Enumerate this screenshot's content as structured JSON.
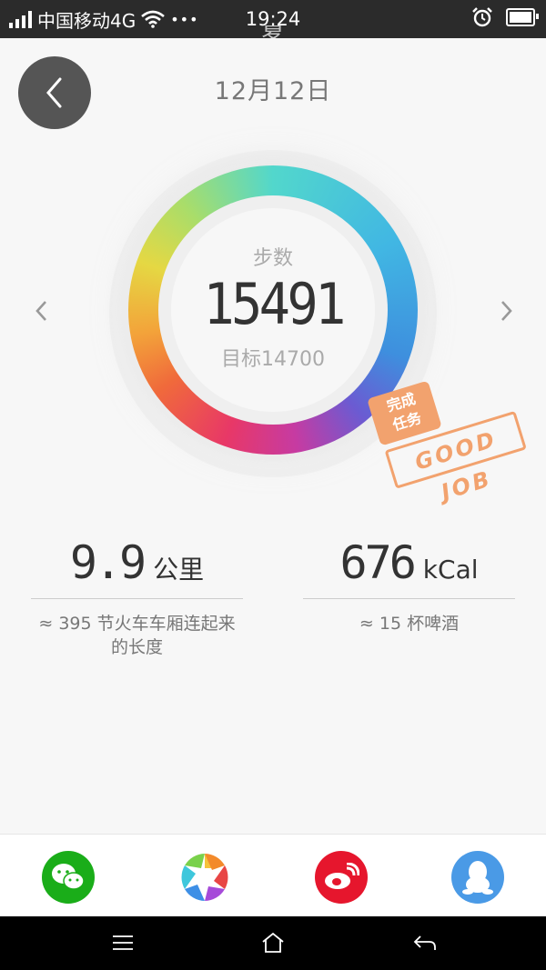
{
  "status_bar": {
    "carrier": "中国移动4G",
    "dots": "•••",
    "time": "19:24",
    "icons": [
      "signal-icon",
      "wifi-icon",
      "alarm-icon",
      "battery-icon"
    ]
  },
  "header": {
    "partial_text": "夏",
    "date": "12月12日",
    "back_icon": "chevron-left-icon"
  },
  "ring": {
    "label": "步数",
    "steps": "15491",
    "goal": "目标14700",
    "progress": 1.0,
    "colors": [
      "#52d7cc",
      "#41b7e3",
      "#6b5bd2",
      "#e83867",
      "#f3a33a",
      "#e5d843",
      "#a9dd6a"
    ]
  },
  "badge": {
    "line1": "完成",
    "line2": "任务",
    "text": "GOOD JOB",
    "color": "#f2a26e"
  },
  "stats": {
    "distance": {
      "value": "9.9",
      "unit": "公里",
      "note": "≈ 395 节火车车厢连起来的长度"
    },
    "calories": {
      "value": "676",
      "unit": "kCal",
      "note": "≈ 15 杯啤酒"
    }
  },
  "share": [
    {
      "name": "wechat",
      "icon": "wechat-icon",
      "color": "#1aad19"
    },
    {
      "name": "moments",
      "icon": "aperture-icon",
      "color": "#ffffff"
    },
    {
      "name": "weibo",
      "icon": "weibo-icon",
      "color": "#e6162d"
    },
    {
      "name": "qq",
      "icon": "qq-penguin-icon",
      "color": "#4a9ae6"
    }
  ],
  "nav": [
    "menu-icon",
    "home-icon",
    "back-icon"
  ]
}
